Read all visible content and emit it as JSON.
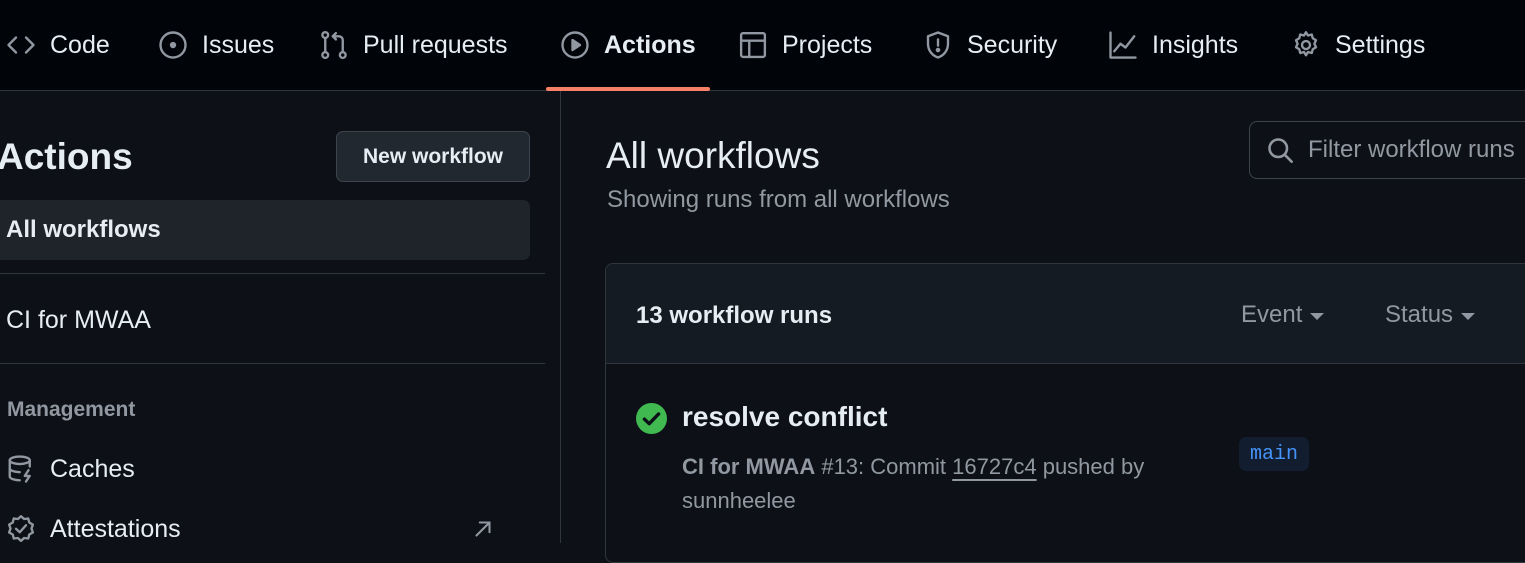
{
  "nav": {
    "tabs": [
      {
        "label": "Code",
        "icon": "code-icon"
      },
      {
        "label": "Issues",
        "icon": "issue-icon"
      },
      {
        "label": "Pull requests",
        "icon": "pull-request-icon"
      },
      {
        "label": "Actions",
        "icon": "play-icon",
        "active": true
      },
      {
        "label": "Projects",
        "icon": "table-icon"
      },
      {
        "label": "Security",
        "icon": "shield-icon"
      },
      {
        "label": "Insights",
        "icon": "graph-icon"
      },
      {
        "label": "Settings",
        "icon": "gear-icon"
      }
    ],
    "active_color": "#f78166"
  },
  "sidebar": {
    "title": "Actions",
    "new_workflow_label": "New workflow",
    "all_workflows_label": "All workflows",
    "workflows": [
      "CI for MWAA"
    ],
    "management_label": "Management",
    "management_items": [
      {
        "label": "Caches",
        "icon": "database-icon"
      },
      {
        "label": "Attestations",
        "icon": "verified-icon",
        "external": true
      }
    ]
  },
  "main": {
    "title": "All workflows",
    "subtitle": "Showing runs from all workflows",
    "filter_placeholder": "Filter workflow runs",
    "runs": {
      "count_label": "13 workflow runs",
      "event_label": "Event",
      "status_label": "Status",
      "items": [
        {
          "title": "resolve conflict",
          "status": "success",
          "workflow": "CI for MWAA",
          "number": "#13",
          "commit_prefix": ": Commit ",
          "commit": "16727c4",
          "pushed_by_text": " pushed by",
          "actor": "sunnheelee",
          "branch": "main"
        }
      ]
    }
  },
  "colors": {
    "background": "#0d1117",
    "success": "#3fb950",
    "branch_text": "#4493f8"
  }
}
